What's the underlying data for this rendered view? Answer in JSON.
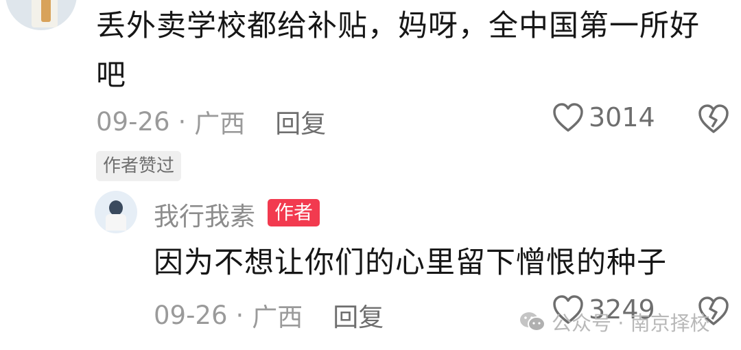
{
  "comment": {
    "text": "丢外卖学校都给补贴，妈呀，全中国第一所好吧",
    "date": "09-26",
    "location": "广西",
    "separator": "·",
    "reply_label": "回复",
    "like_count": "3014",
    "liked_badge": "作者赞过"
  },
  "reply": {
    "username": "我行我素",
    "author_badge": "作者",
    "text": "因为不想让你们的心里留下憎恨的种子",
    "date": "09-26",
    "location": "广西",
    "separator": "·",
    "reply_label": "回复",
    "like_count": "3249"
  },
  "watermark": {
    "text": "公众号 · 南京择校"
  },
  "icons": {
    "like": "heart-outline-icon",
    "dislike": "broken-heart-icon",
    "wechat": "wechat-icon"
  },
  "colors": {
    "author_badge_bg": "#f23a4f",
    "text_primary": "#161616",
    "text_secondary": "#9a9a9a"
  }
}
